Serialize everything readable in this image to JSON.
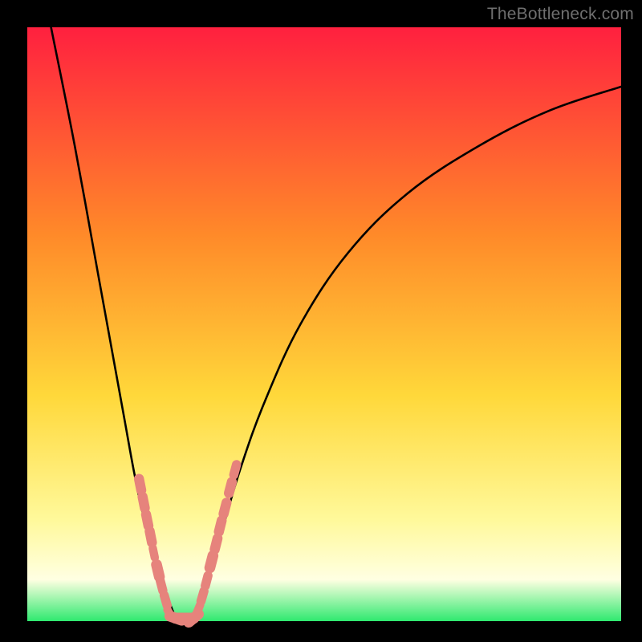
{
  "watermark": "TheBottleneck.com",
  "colors": {
    "frame": "#000000",
    "grad_top": "#ff203f",
    "grad_mid1": "#ff8a29",
    "grad_mid2": "#ffd83a",
    "grad_mid3": "#fff99b",
    "grad_bottom": "#2fe96f",
    "curve": "#000000",
    "marker_fill": "#e6837c",
    "marker_stroke": "#d86c66"
  },
  "chart_data": {
    "type": "line",
    "title": "",
    "xlabel": "",
    "ylabel": "",
    "xlim": [
      0,
      100
    ],
    "ylim": [
      0,
      100
    ],
    "series": [
      {
        "name": "left-branch",
        "x": [
          4,
          8,
          12,
          16,
          18,
          19.5,
          21,
          22.5,
          24,
          25
        ],
        "y": [
          100,
          80,
          58,
          36,
          25,
          18,
          12,
          7,
          3,
          0.5
        ]
      },
      {
        "name": "right-branch",
        "x": [
          28,
          29.5,
          31,
          33,
          36,
          40,
          46,
          54,
          64,
          76,
          88,
          100
        ],
        "y": [
          0.5,
          4,
          9,
          16,
          26,
          37,
          50,
          62,
          72,
          80,
          86,
          90
        ]
      }
    ],
    "markers": [
      {
        "x": 19.0,
        "y": 23.0,
        "size": 2.4
      },
      {
        "x": 19.6,
        "y": 20.0,
        "size": 2.4
      },
      {
        "x": 20.2,
        "y": 17.0,
        "size": 2.4
      },
      {
        "x": 20.8,
        "y": 14.2,
        "size": 2.4
      },
      {
        "x": 21.3,
        "y": 11.5,
        "size": 2.0
      },
      {
        "x": 22.0,
        "y": 8.5,
        "size": 2.6
      },
      {
        "x": 22.6,
        "y": 6.0,
        "size": 2.2
      },
      {
        "x": 23.3,
        "y": 3.5,
        "size": 2.2
      },
      {
        "x": 24.0,
        "y": 1.2,
        "size": 2.0
      },
      {
        "x": 25.0,
        "y": 0.5,
        "size": 2.6
      },
      {
        "x": 26.0,
        "y": 0.5,
        "size": 2.6
      },
      {
        "x": 27.0,
        "y": 0.5,
        "size": 2.6
      },
      {
        "x": 28.0,
        "y": 0.5,
        "size": 2.6
      },
      {
        "x": 28.8,
        "y": 2.0,
        "size": 2.0
      },
      {
        "x": 29.5,
        "y": 4.2,
        "size": 2.2
      },
      {
        "x": 30.2,
        "y": 6.8,
        "size": 2.2
      },
      {
        "x": 31.0,
        "y": 10.0,
        "size": 2.6
      },
      {
        "x": 31.8,
        "y": 13.0,
        "size": 2.4
      },
      {
        "x": 32.5,
        "y": 16.0,
        "size": 2.4
      },
      {
        "x": 33.3,
        "y": 19.0,
        "size": 2.4
      },
      {
        "x": 34.2,
        "y": 22.5,
        "size": 2.4
      },
      {
        "x": 35.0,
        "y": 25.5,
        "size": 2.2
      }
    ]
  }
}
